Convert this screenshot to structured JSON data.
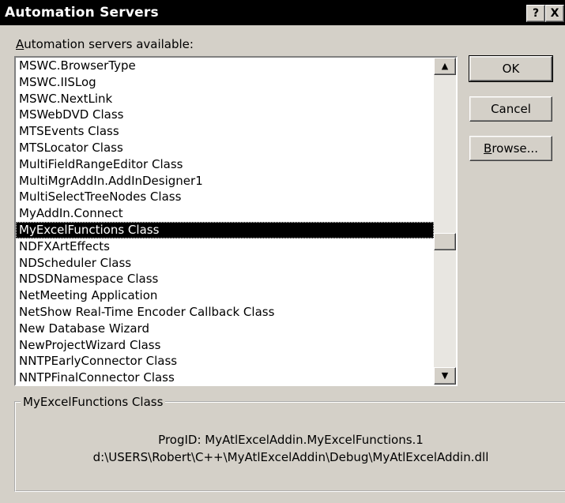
{
  "window": {
    "title": "Automation Servers",
    "help_label": "?",
    "close_label": "X"
  },
  "list": {
    "label_accel": "A",
    "label_rest": "utomation servers available:",
    "items": [
      "MSWC.BrowserType",
      "MSWC.IISLog",
      "MSWC.NextLink",
      "MSWebDVD Class",
      "MTSEvents Class",
      "MTSLocator Class",
      "MultiFieldRangeEditor Class",
      "MultiMgrAddIn.AddInDesigner1",
      "MultiSelectTreeNodes Class",
      "MyAddIn.Connect",
      "MyExcelFunctions Class",
      "NDFXArtEffects",
      "NDScheduler Class",
      "NDSDNamespace Class",
      "NetMeeting Application",
      "NetShow Real-Time Encoder Callback Class",
      "New Database Wizard",
      "NewProjectWizard Class",
      "NNTPEarlyConnector Class",
      "NNTPFinalConnector Class"
    ],
    "selected_index": 10
  },
  "buttons": {
    "ok": "OK",
    "cancel": "Cancel",
    "browse_accel": "B",
    "browse_rest": "rowse..."
  },
  "scrollbar": {
    "up_glyph": "▲",
    "down_glyph": "▼"
  },
  "info": {
    "group_title": "MyExcelFunctions Class",
    "progid": "ProgID: MyAtlExcelAddin.MyExcelFunctions.1",
    "path": "d:\\USERS\\Robert\\C++\\MyAtlExcelAddin\\Debug\\MyAtlExcelAddin.dll"
  }
}
